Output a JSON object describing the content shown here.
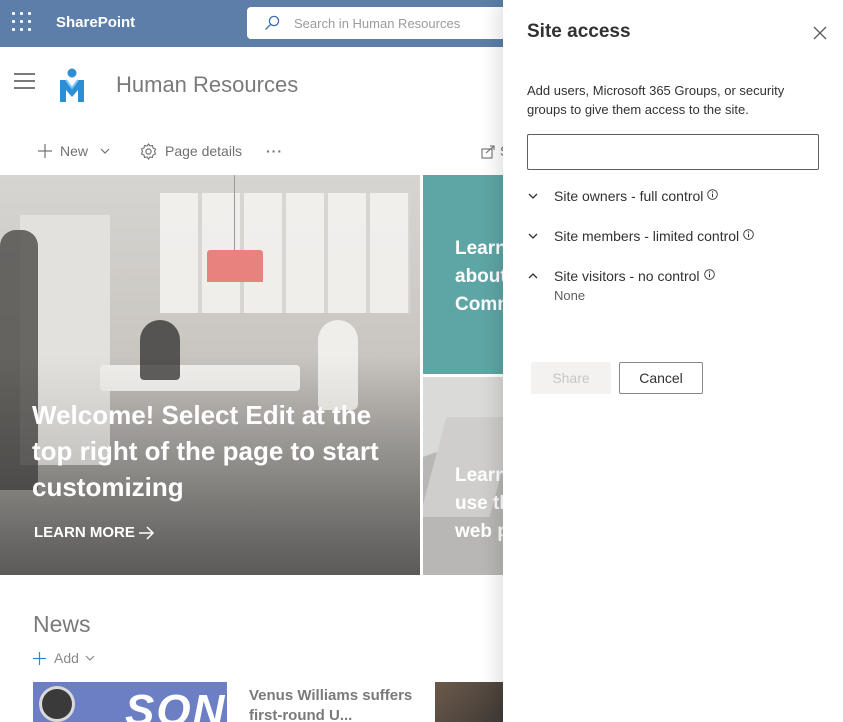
{
  "suite_bar": {
    "app_name": "SharePoint",
    "search_placeholder": "Search in Human Resources"
  },
  "site": {
    "title": "Human Resources"
  },
  "command_bar": {
    "new_label": "New",
    "page_details_label": "Page details",
    "more_label": "···",
    "share_partial": "S"
  },
  "hero": {
    "main": {
      "headline": "Welcome! Select Edit at the top right of the page to start customizing",
      "link_label": "LEARN MORE"
    },
    "tile_top": {
      "lines": [
        "Learn",
        "about",
        "Comm"
      ]
    },
    "tile_bottom": {
      "lines": [
        "Learn",
        "use th",
        "web p"
      ]
    }
  },
  "news": {
    "title": "News",
    "add_label": "Add",
    "items": [
      {
        "headline": "Venus Williams suffers first-round U...",
        "image_text": "SON"
      }
    ]
  },
  "panel": {
    "title": "Site access",
    "description": "Add users, Microsoft 365 Groups, or security groups to give them access to the site.",
    "input_value": "",
    "groups": [
      {
        "label": "Site owners - full control",
        "expanded": false
      },
      {
        "label": "Site members - limited control",
        "expanded": false
      },
      {
        "label": "Site visitors - no control",
        "expanded": true,
        "note": "None"
      }
    ],
    "share_label": "Share",
    "cancel_label": "Cancel"
  },
  "colors": {
    "suite_bar": "#5c7ea8",
    "tile_teal": "#5ea6a6",
    "text_primary": "#323130"
  }
}
